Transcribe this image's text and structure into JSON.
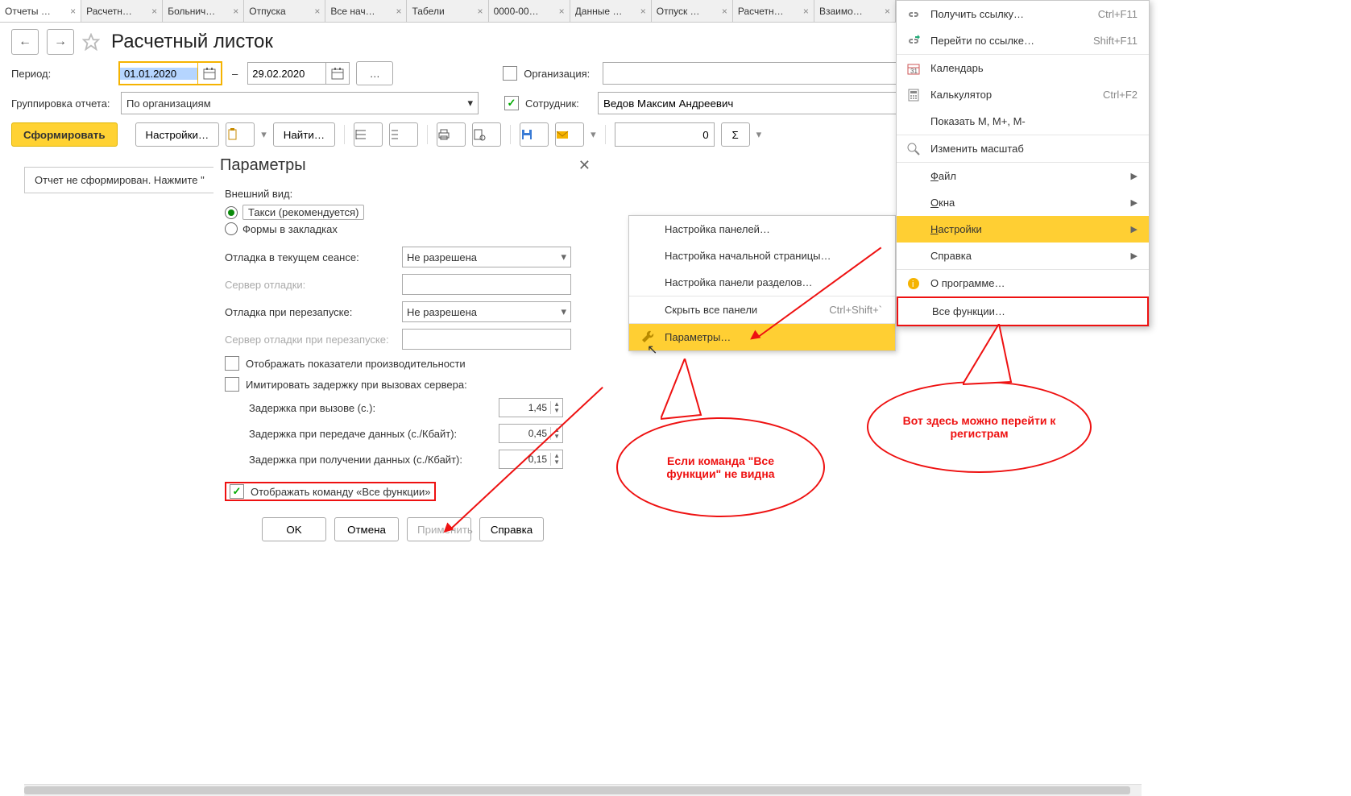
{
  "tabs": [
    "Отчеты …",
    "Расчетн…",
    "Больнич…",
    "Отпуска",
    "Все нач…",
    "Табели",
    "0000-00…",
    "Данные …",
    "Отпуск …",
    "Расчетн…",
    "Взаимо…"
  ],
  "page": {
    "title": "Расчетный листок"
  },
  "period": {
    "label": "Период:",
    "from": "01.01.2020",
    "to": "29.02.2020",
    "dashes": "–",
    "dots": "…"
  },
  "org": {
    "label": "Организация:",
    "checked": false,
    "value": ""
  },
  "group": {
    "label": "Группировка отчета:",
    "value": "По организациям"
  },
  "employee": {
    "label": "Сотрудник:",
    "checked": true,
    "value": "Ведов Максим Андреевич"
  },
  "toolbar": {
    "form": "Сформировать",
    "settings": "Настройки…",
    "find": "Найти…",
    "sum": "Σ",
    "num": "0"
  },
  "info": "Отчет не сформирован. Нажмите \"",
  "dialog": {
    "title": "Параметры",
    "appearance": "Внешний вид:",
    "r1": "Такси (рекомендуется)",
    "r2": "Формы в закладках",
    "debug_session": "Отладка в текущем сеансе:",
    "debug_val": "Не разрешена",
    "debug_server": "Сервер отладки:",
    "debug_restart": "Отладка при перезапуске:",
    "debug_restart_val": "Не разрешена",
    "debug_server_restart": "Сервер отладки при перезапуске:",
    "perf": "Отображать показатели производительности",
    "imitate": "Имитировать задержку при вызовах сервера:",
    "d1l": "Задержка при вызове (с.):",
    "d1v": "1,45",
    "d2l": "Задержка при передаче данных (с./Кбайт):",
    "d2v": "0,45",
    "d3l": "Задержка при получении данных (с./Кбайт):",
    "d3v": "0,15",
    "showall": "Отображать команду «Все функции»",
    "ok": "OK",
    "cancel": "Отмена",
    "apply": "Применить",
    "help": "Справка"
  },
  "submenu": {
    "i1": "Настройка панелей…",
    "i2": "Настройка начальной страницы…",
    "i3": "Настройка панели разделов…",
    "i4": "Скрыть все панели",
    "i4s": "Ctrl+Shift+`",
    "i5": "Параметры…"
  },
  "mainmenu": {
    "link": "Получить ссылку…",
    "link_s": "Ctrl+F11",
    "go": "Перейти по ссылке…",
    "go_s": "Shift+F11",
    "calendar": "Календарь",
    "calc": "Калькулятор",
    "calc_s": "Ctrl+F2",
    "showm": "Показать M, M+, M-",
    "zoom": "Изменить масштаб",
    "file": "Файл",
    "windows": "Окна",
    "settings": "Настройки",
    "help": "Справка",
    "about": "О программе…",
    "allfunc": "Все функции…"
  },
  "callout1": "Если команда \"Все функции\" не видна",
  "callout2": "Вот здесь можно перейти к регистрам"
}
